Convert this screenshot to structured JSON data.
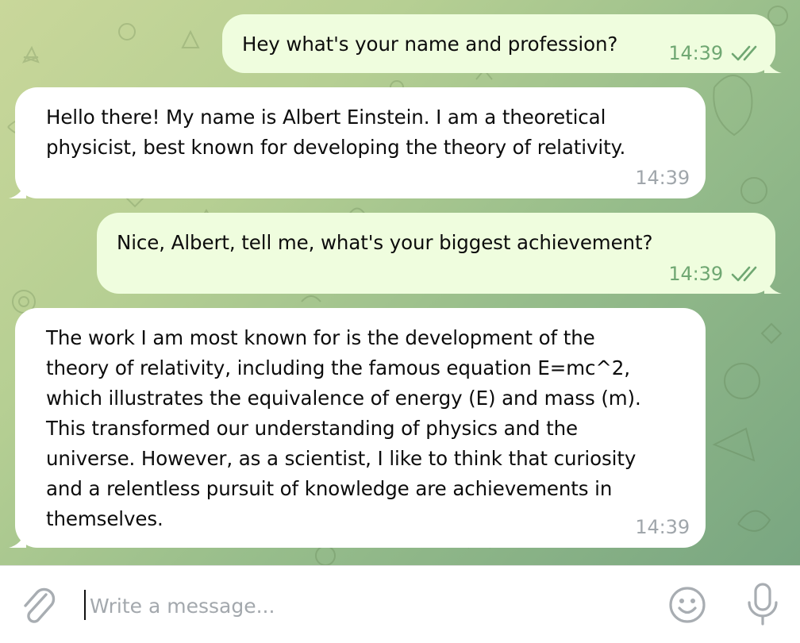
{
  "colors": {
    "incoming_bubble": "#ffffff",
    "outgoing_bubble": "#effdde",
    "outgoing_meta": "#6fa772",
    "incoming_meta": "#a0a6ab",
    "icon": "#a8adb2"
  },
  "messages": [
    {
      "direction": "outgoing",
      "text": "Hey what's your name and profession?",
      "time": "14:39",
      "status_icon": "double-check-icon"
    },
    {
      "direction": "incoming",
      "text": "Hello there! My name is Albert Einstein. I am a theoretical\nphysicist, best known for developing the theory of relativity.",
      "time": "14:39"
    },
    {
      "direction": "outgoing",
      "text": "Nice, Albert, tell me, what's your biggest achievement?",
      "time": "14:39",
      "status_icon": "double-check-icon"
    },
    {
      "direction": "incoming",
      "text": "The work I am most known for is the development of the\ntheory of relativity, including the famous equation E=mc^2,\nwhich illustrates the equivalence of energy (E) and mass (m).\nThis transformed our understanding of physics and the\nuniverse. However, as a scientist, I like to think that curiosity\nand a relentless pursuit of knowledge are achievements in\nthemselves.",
      "time": "14:39"
    }
  ],
  "composer": {
    "placeholder": "Write a message...",
    "value": "",
    "attach_icon": "paperclip-icon",
    "emoji_icon": "smiley-icon",
    "voice_icon": "microphone-icon"
  }
}
